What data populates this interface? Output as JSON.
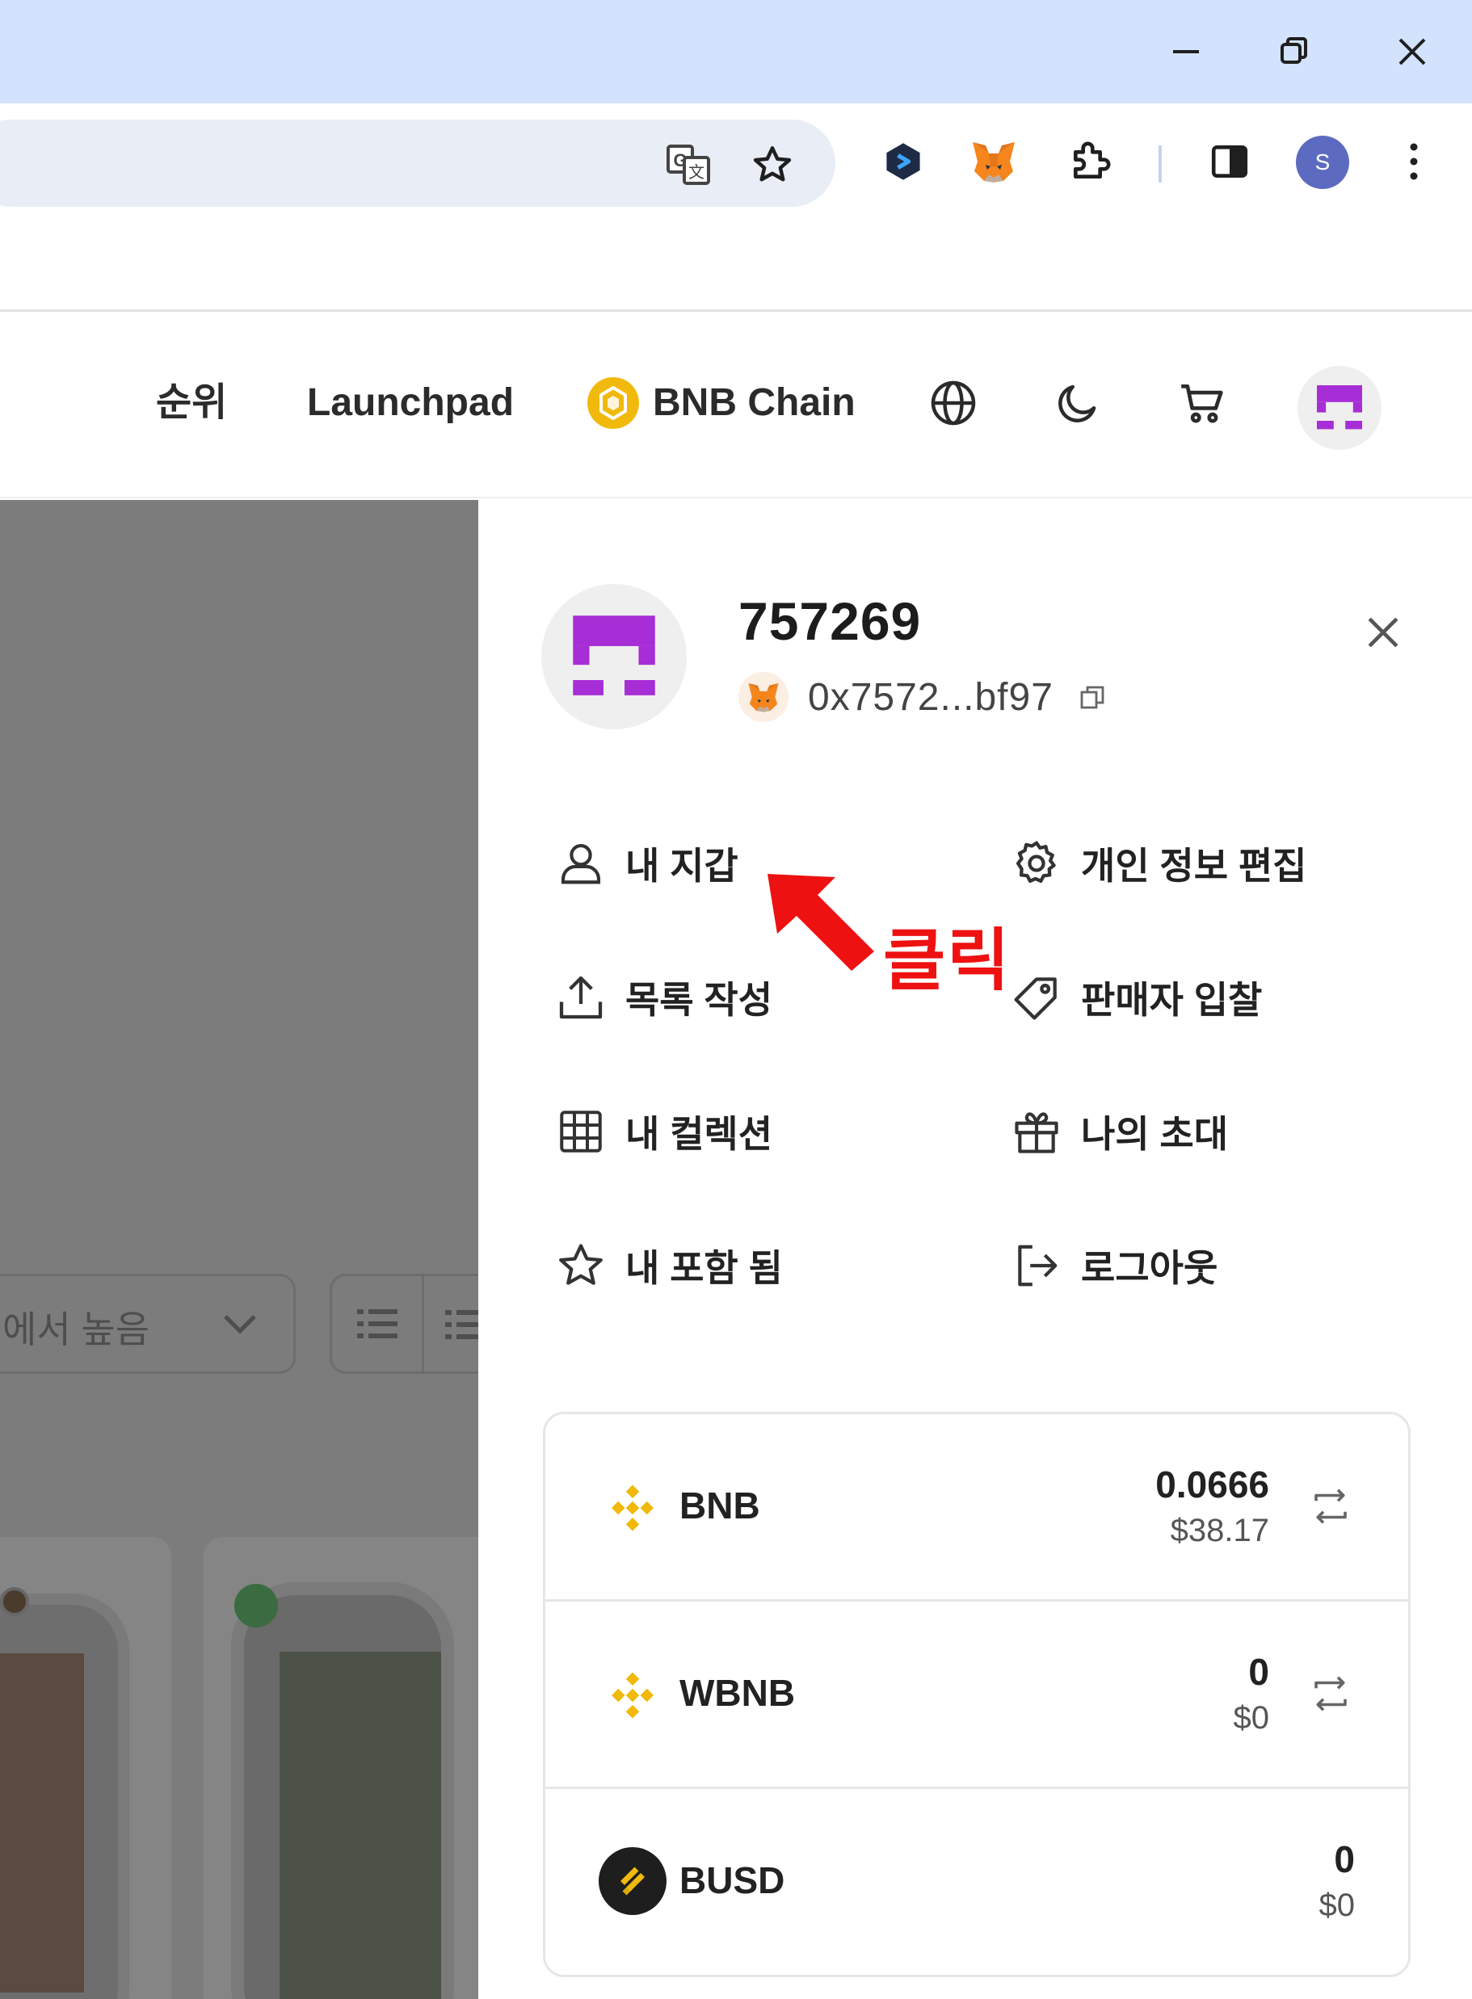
{
  "browser": {
    "window_controls": [
      "minimize",
      "restore",
      "close"
    ],
    "toolbar_icons": [
      "translate-icon",
      "star-icon",
      "extension-hexagon-icon",
      "metamask-icon",
      "puzzle-icon",
      "side-panel-icon",
      "profile-avatar",
      "menu-kebab-icon"
    ],
    "profile_initial": "S",
    "accent": "#d3e3fd"
  },
  "header": {
    "nav": {
      "ranking": "순위",
      "launchpad": "Launchpad",
      "chain": "BNB Chain"
    },
    "icons": [
      "globe-icon",
      "moon-icon",
      "cart-icon",
      "user-avatar"
    ]
  },
  "background_page": {
    "sort_label": "에서 높음"
  },
  "drawer": {
    "username": "757269",
    "wallet_address": "0x7572...bf97",
    "menu": {
      "my_wallet": "내 지갑",
      "edit_profile": "개인 정보 편집",
      "create_listing": "목록 작성",
      "seller_bid": "판매자 입찰",
      "my_collection": "내 컬렉션",
      "my_invite": "나의 초대",
      "my_favorites": "내 포함 됨",
      "logout": "로그아웃"
    },
    "annotation": "클릭",
    "tokens": [
      {
        "symbol": "BNB",
        "amount": "0.0666",
        "usd": "$38.17"
      },
      {
        "symbol": "WBNB",
        "amount": "0",
        "usd": "$0"
      },
      {
        "symbol": "BUSD",
        "amount": "0",
        "usd": "$0"
      }
    ],
    "colors": {
      "avatar_purple": "#a72ed6",
      "bnb_yellow": "#f0b90b",
      "annotation_red": "#ee1111"
    }
  }
}
